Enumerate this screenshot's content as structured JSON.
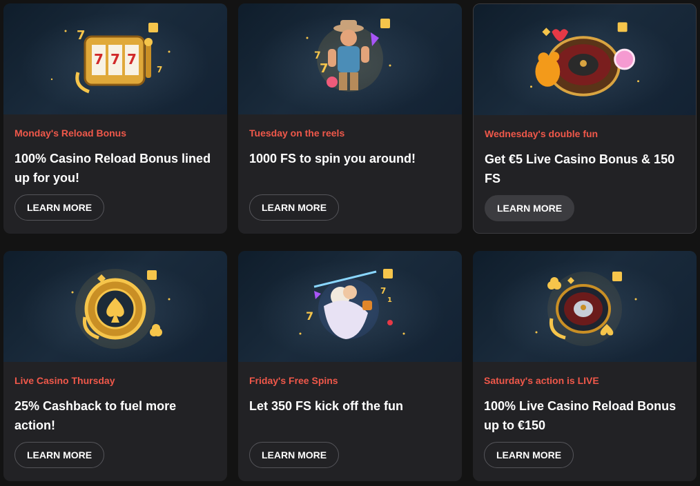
{
  "promotions": [
    {
      "subtitle": "Monday's Reload Bonus",
      "title": "100% Casino Reload Bonus lined up for you!",
      "button": "LEARN MORE",
      "icon": "slot-machine-icon"
    },
    {
      "subtitle": "Tuesday on the reels",
      "title": "1000 FS to spin you around!",
      "button": "LEARN MORE",
      "icon": "cowboy-character-icon"
    },
    {
      "subtitle": "Wednesday's double fun",
      "title": "Get €5 Live Casino Bonus & 150 FS",
      "button": "LEARN MORE",
      "icon": "roulette-candy-icon"
    },
    {
      "subtitle": "Live Casino Thursday",
      "title": "25% Cashback to fuel more action!",
      "button": "LEARN MORE",
      "icon": "poker-chip-spade-icon"
    },
    {
      "subtitle": "Friday's Free Spins",
      "title": "Let 350 FS kick off the fun",
      "button": "LEARN MORE",
      "icon": "zeus-character-icon"
    },
    {
      "subtitle": "Saturday's action is LIVE",
      "title": "100% Live Casino Reload Bonus up to €150",
      "button": "LEARN MORE",
      "icon": "roulette-wheel-icon"
    }
  ],
  "colors": {
    "accent": "#f0584a",
    "card": "#222225",
    "background": "#131313",
    "gold": "#f6c54b"
  }
}
